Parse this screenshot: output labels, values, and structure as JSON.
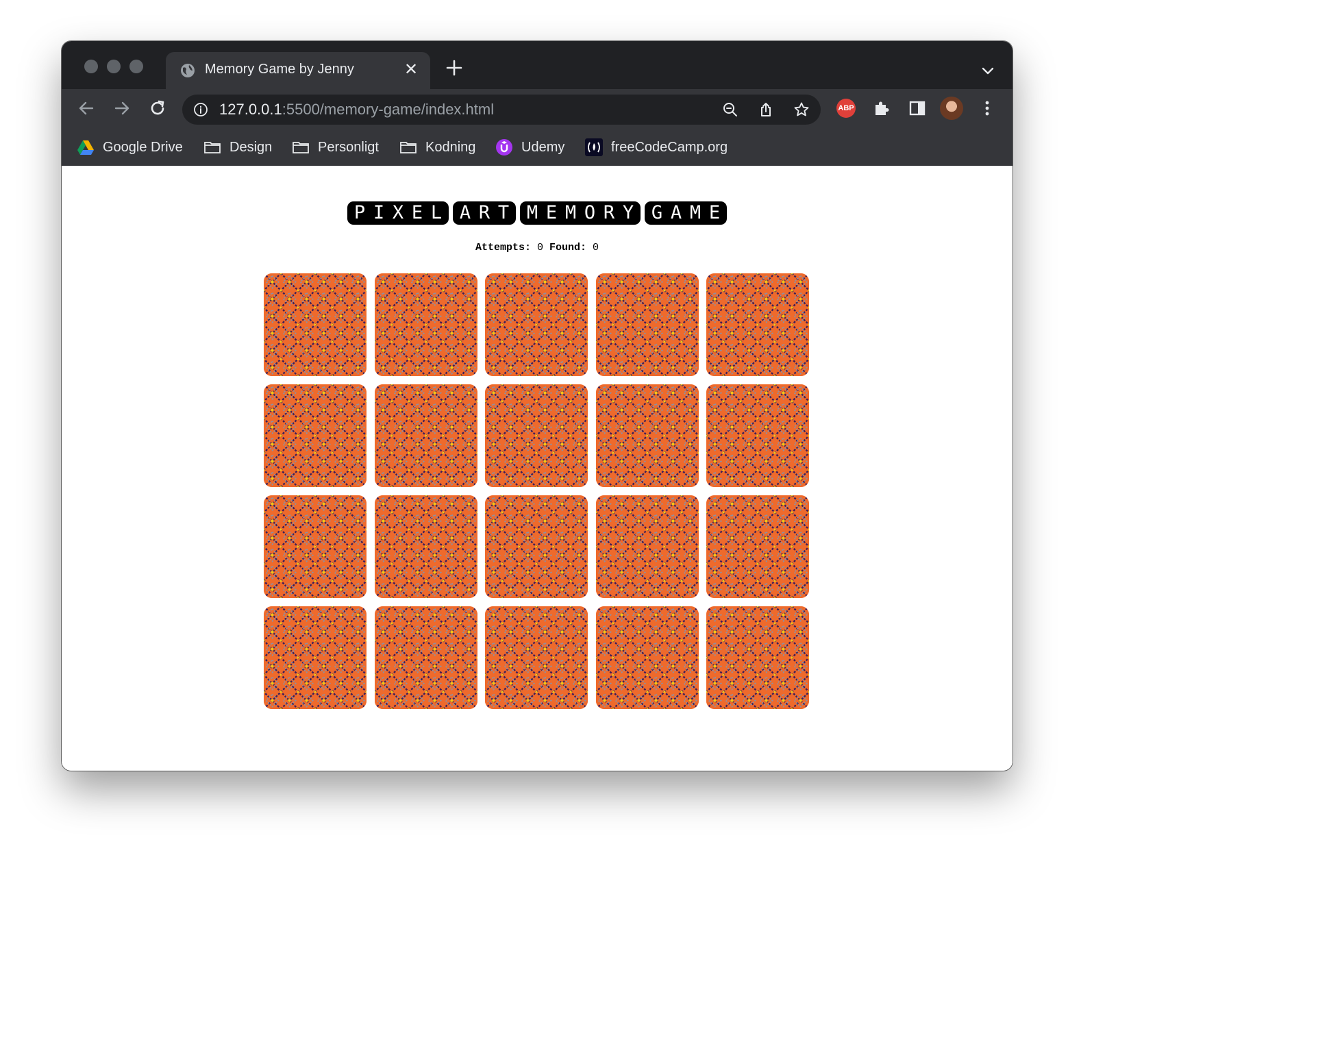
{
  "browser": {
    "tab_title": "Memory Game by Jenny",
    "tab_close": "✕",
    "url_host": "127.0.0.1",
    "url_path": ":5500/memory-game/index.html",
    "bookmarks": [
      "Google Drive",
      "Design",
      "Personligt",
      "Kodning",
      "Udemy",
      "freeCodeCamp.org"
    ],
    "extension_abp": "ABP"
  },
  "game": {
    "title_words": [
      "PIXEL",
      "ART",
      "MEMORY",
      "GAME"
    ],
    "attempts_label": "Attempts:",
    "attempts_value": "0",
    "found_label": "Found:",
    "found_value": "0",
    "card_count": 20,
    "columns": 5,
    "card_back_colors": {
      "base": "#ee6a2c",
      "lattice": "#3b1f5a",
      "accent": "#f5c518",
      "muted": "#8f8fa0"
    }
  }
}
